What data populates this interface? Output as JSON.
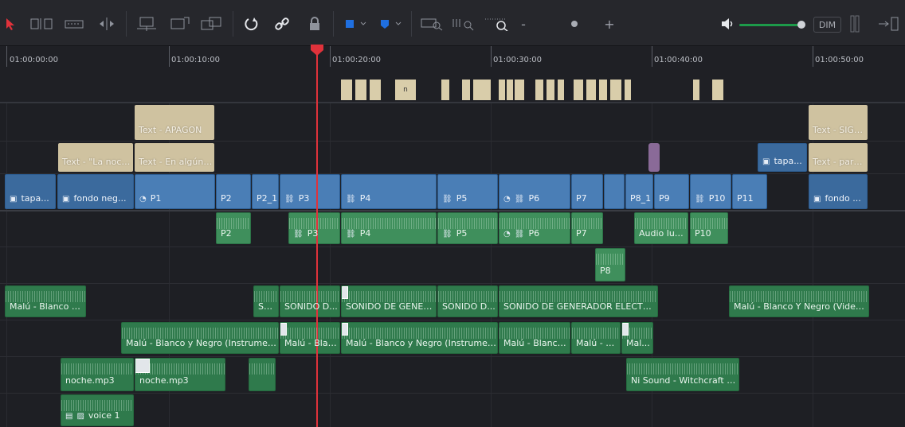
{
  "toolbar": {
    "tools": [
      {
        "name": "selection-tool"
      },
      {
        "name": "trim-tool"
      },
      {
        "name": "dynamic-trim-tool"
      },
      {
        "name": "blade-tool"
      },
      {
        "name": "insert-clip"
      },
      {
        "name": "overwrite-clip"
      },
      {
        "name": "replace-clip"
      },
      {
        "name": "snapping"
      },
      {
        "name": "linked-selection"
      },
      {
        "name": "position-lock"
      },
      {
        "name": "flag"
      },
      {
        "name": "marker"
      },
      {
        "name": "zoom-full"
      },
      {
        "name": "zoom-detail"
      },
      {
        "name": "zoom-custom"
      }
    ],
    "zoom_minus": "-",
    "zoom_plus": "+",
    "dim_label": "DIM",
    "accent_color": "#1d9a4a"
  },
  "ruler": {
    "timecodes": [
      "01:00:00:00",
      "01:00:10:00",
      "01:00:20:00",
      "01:00:30:00",
      "01:00:40:00",
      "01:00:50:00"
    ],
    "marker_label": "n"
  },
  "playhead": {
    "color": "#e0323b"
  },
  "clips": {
    "text": [
      {
        "label": "Text - APAGON"
      },
      {
        "label": "Text - SIGU..."
      },
      {
        "label": "Text - \"La noch..."
      },
      {
        "label": "Text - En algún l..."
      },
      {
        "label": "Text - para ..."
      }
    ],
    "video": [
      {
        "label": "tapa..."
      },
      {
        "label": "fondo neg..."
      },
      {
        "label": "P1"
      },
      {
        "label": "P2"
      },
      {
        "label": "P2_1"
      },
      {
        "label": "P3"
      },
      {
        "label": "P4"
      },
      {
        "label": "P5"
      },
      {
        "label": "P6"
      },
      {
        "label": "P7"
      },
      {
        "label": "P8_1"
      },
      {
        "label": "P9"
      },
      {
        "label": "P10"
      },
      {
        "label": "P11"
      },
      {
        "label": "tapa..."
      },
      {
        "label": "fondo ..."
      }
    ],
    "audio1": [
      {
        "label": "P2"
      },
      {
        "label": "P3"
      },
      {
        "label": "P4"
      },
      {
        "label": "P5"
      },
      {
        "label": "P6"
      },
      {
        "label": "P7"
      },
      {
        "label": "Audio luz..."
      },
      {
        "label": "P10"
      }
    ],
    "audio2": [
      {
        "label": "P8"
      }
    ],
    "audio3": [
      {
        "label": "Malú - Blanco Y ..."
      },
      {
        "label": "SO..."
      },
      {
        "label": "SONIDO D..."
      },
      {
        "label": "SONIDO DE GENER..."
      },
      {
        "label": "SONIDO D..."
      },
      {
        "label": "SONIDO DE GENERADOR ELECTRIC..."
      },
      {
        "label": "Malú - Blanco Y Negro (Videocli..."
      }
    ],
    "audio4": [
      {
        "label": "Malú - Blanco y Negro (Instrumenta..."
      },
      {
        "label": "Malú - Blan..."
      },
      {
        "label": "Malú - Blanco y Negro (Instrument..."
      },
      {
        "label": "Malú - Blanco ..."
      },
      {
        "label": "Malú - Bl..."
      },
      {
        "label": "Mal..."
      }
    ],
    "audio5": [
      {
        "label": "noche.mp3"
      },
      {
        "label": "noche.mp3"
      },
      {
        "label": "Ni Sound - Witchcraft - S..."
      }
    ],
    "audio6": [
      {
        "label": "voice 1"
      }
    ]
  }
}
